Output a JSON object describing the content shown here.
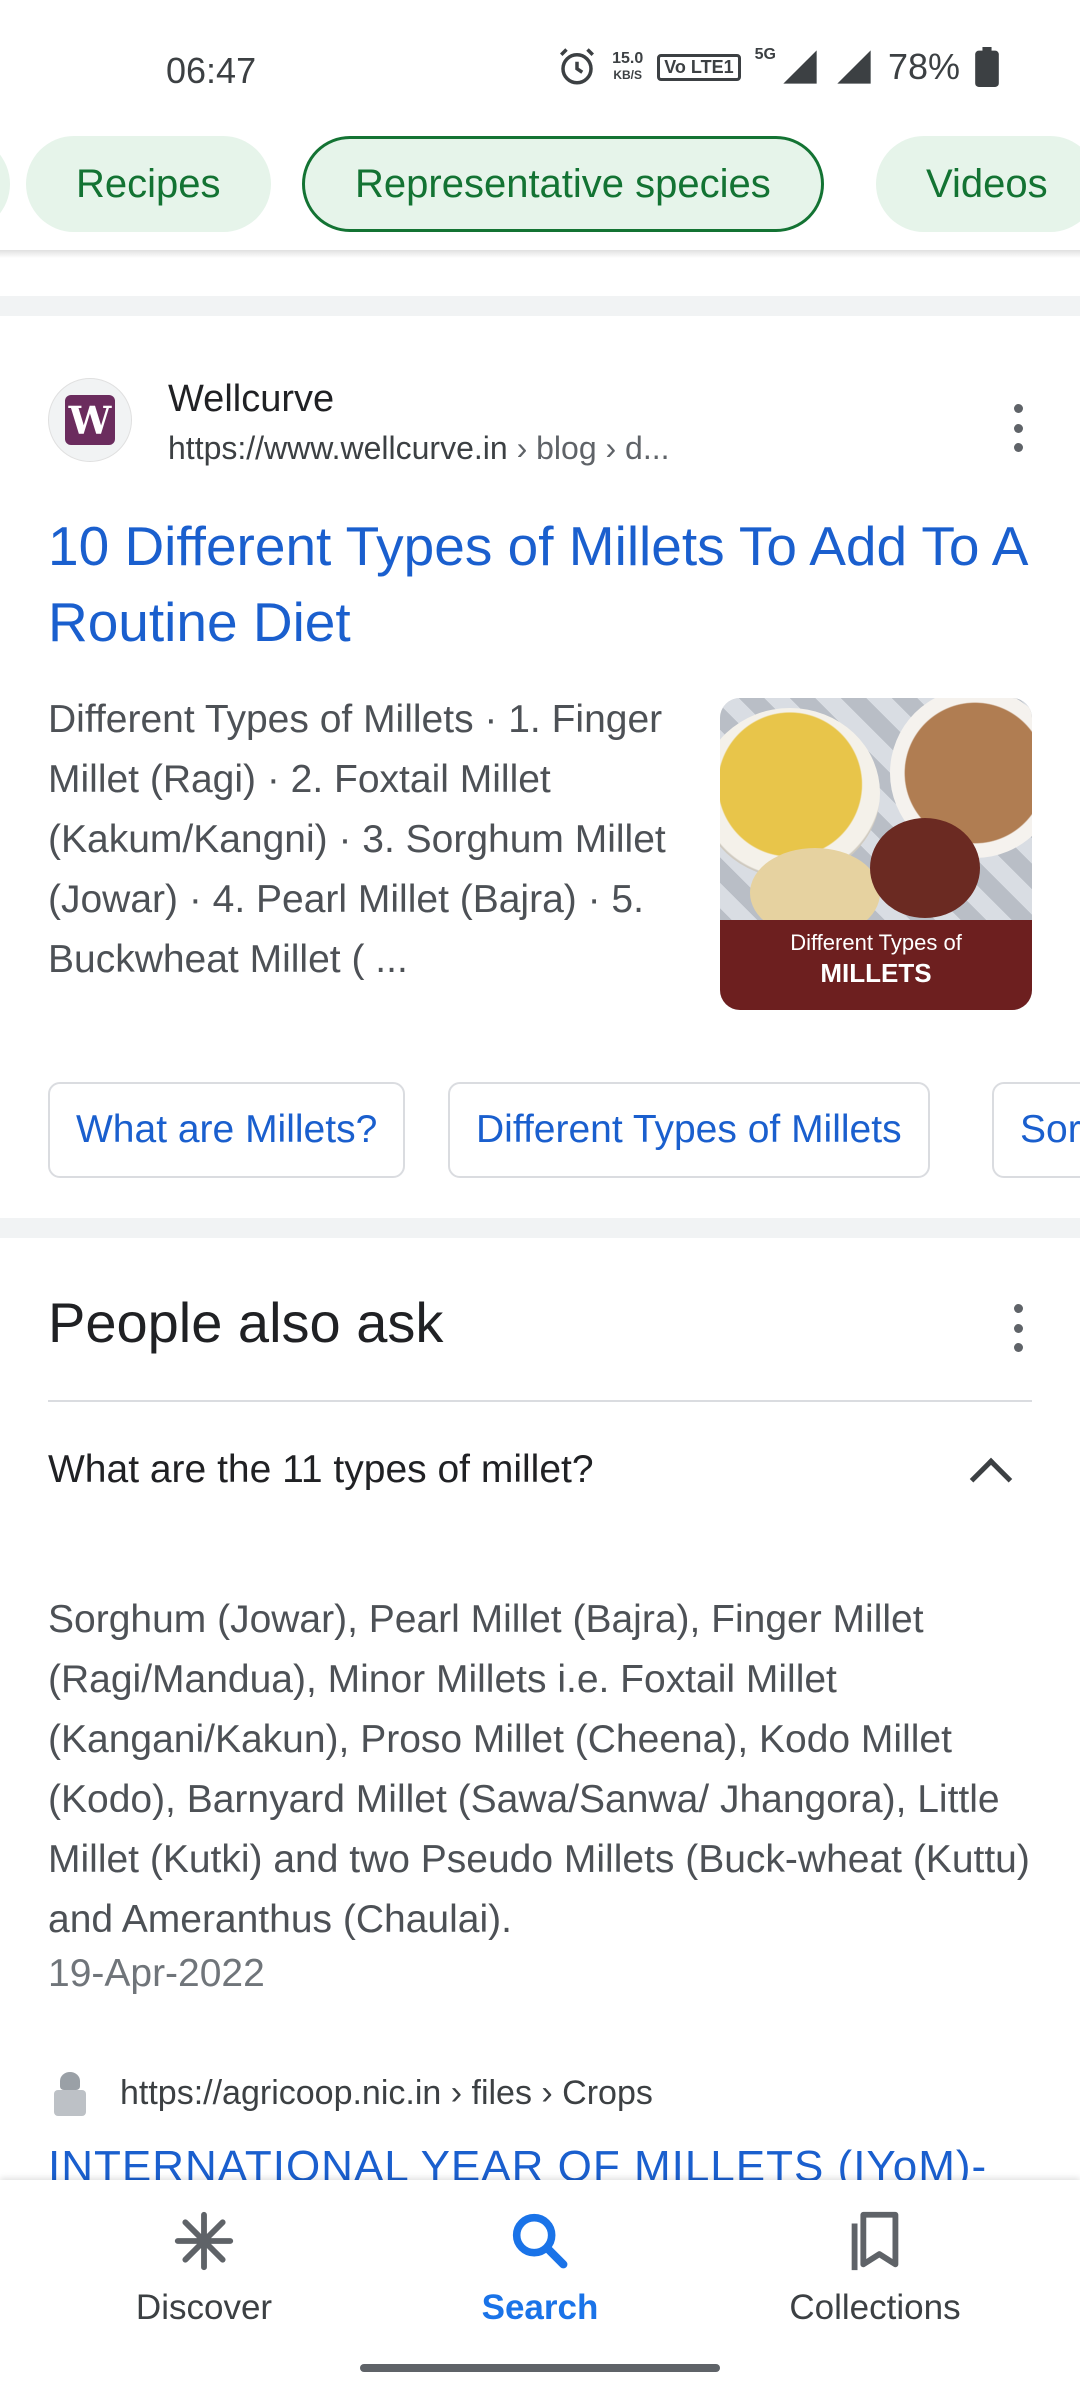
{
  "status_bar": {
    "time": "06:47",
    "net_speed_value": "15.0",
    "net_speed_unit": "KB/S",
    "volte": "Vo LTE1",
    "network": "5G",
    "battery": "78%"
  },
  "chips": [
    {
      "label": "Recipes",
      "selected": false
    },
    {
      "label": "Representative species",
      "selected": true
    },
    {
      "label": "Videos",
      "selected": false
    }
  ],
  "result": {
    "site_name": "Wellcurve",
    "url": "https://www.wellcurve.in",
    "breadcrumb": " › blog › d...",
    "favicon_letter": "W",
    "title": "10 Different Types of Millets To Add To A Routine Diet",
    "snippet": "Different Types of Millets · 1. Finger Millet (Ragi) · 2. Foxtail Millet (Kakum/Kangni) · 3. Sorghum Millet (Jowar) · 4. Pearl Millet (Bajra) · 5. Buckwheat Millet ( ...",
    "thumbnail_text_line1": "Different Types of",
    "thumbnail_text_line2": "MILLETS",
    "sitelinks": [
      "What are Millets?",
      "Different Types of Millets",
      "Sor"
    ]
  },
  "people_also_ask": {
    "heading": "People also ask",
    "question": "What are the 11 types of millet?",
    "answer": "Sorghum (Jowar), Pearl Millet (Bajra), Finger Millet (Ragi/Mandua), Minor Millets i.e. Foxtail Millet (Kangani/Kakun), Proso Millet (Cheena), Kodo Millet (Kodo), Barnyard Millet (Sawa/Sanwa/ Jhangora), Little Millet (Kutki) and two Pseudo Millets (Buck-wheat (Kuttu) and Ameranthus (Chaulai).",
    "date": "19-Apr-2022",
    "source_url": "https://agricoop.nic.in › files › Crops",
    "source_title": "INTERNATIONAL YEAR OF MILLETS (IYoM)-"
  },
  "bottom_nav": {
    "items": [
      {
        "label": "Discover",
        "icon": "asterisk-icon",
        "active": false
      },
      {
        "label": "Search",
        "icon": "search-icon",
        "active": true
      },
      {
        "label": "Collections",
        "icon": "bookmarks-icon",
        "active": false
      }
    ]
  },
  "colors": {
    "link_blue": "#1a5fce",
    "chip_green_bg": "#e6f4ea",
    "chip_green_text": "#137333",
    "nav_active": "#1a73e8"
  }
}
